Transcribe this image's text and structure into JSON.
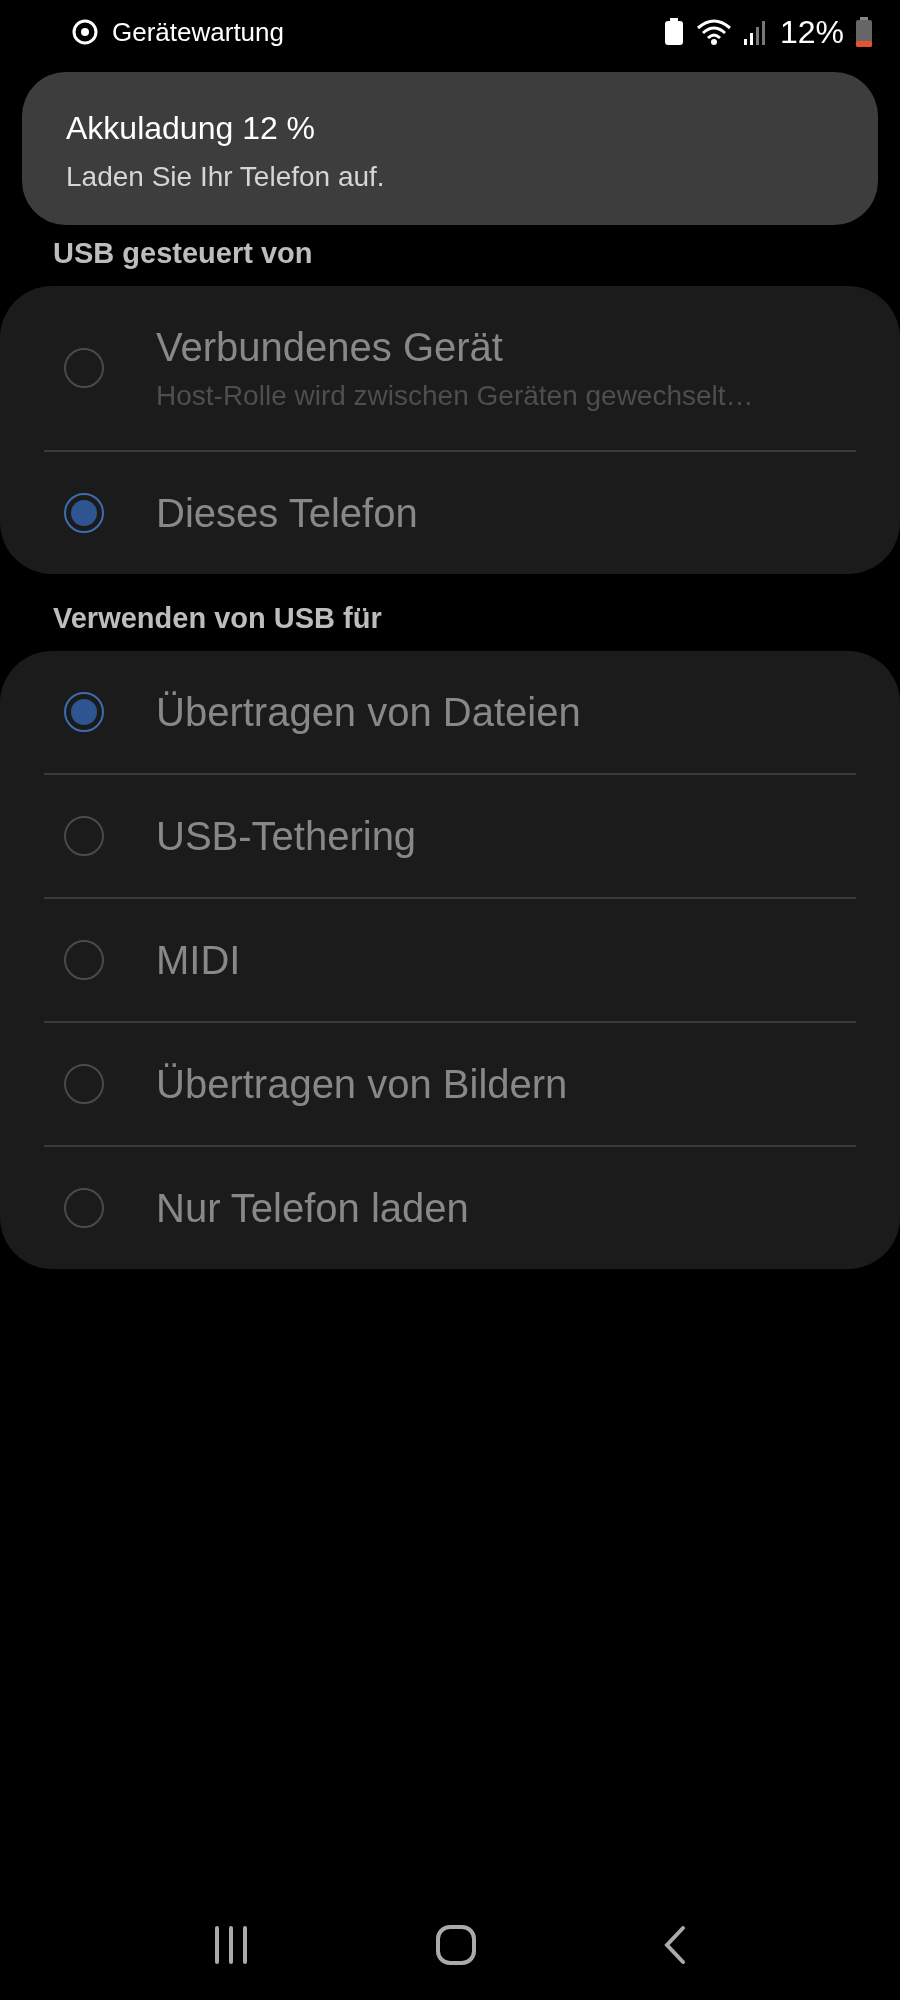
{
  "status_bar": {
    "notification": "Gerätewartung",
    "battery": "12%"
  },
  "toast": {
    "title": "Akkuladung 12 %",
    "message": "Laden Sie Ihr Telefon auf."
  },
  "sections": [
    {
      "title": "USB gesteuert von",
      "options": [
        {
          "label": "Verbundenes Gerät",
          "subtitle": "Host-Rolle wird zwischen Geräten gewechselt…",
          "selected": false,
          "disabled": true
        },
        {
          "label": "Dieses Telefon",
          "selected": true,
          "disabled": true
        }
      ]
    },
    {
      "title": "Verwenden von USB für",
      "options": [
        {
          "label": "Übertragen von Dateien",
          "selected": true,
          "disabled": true
        },
        {
          "label": "USB-Tethering",
          "selected": false,
          "disabled": true
        },
        {
          "label": "MIDI",
          "selected": false,
          "disabled": true
        },
        {
          "label": "Übertragen von Bildern",
          "selected": false,
          "disabled": true
        },
        {
          "label": "Nur Telefon laden",
          "selected": false,
          "disabled": true
        }
      ]
    }
  ]
}
